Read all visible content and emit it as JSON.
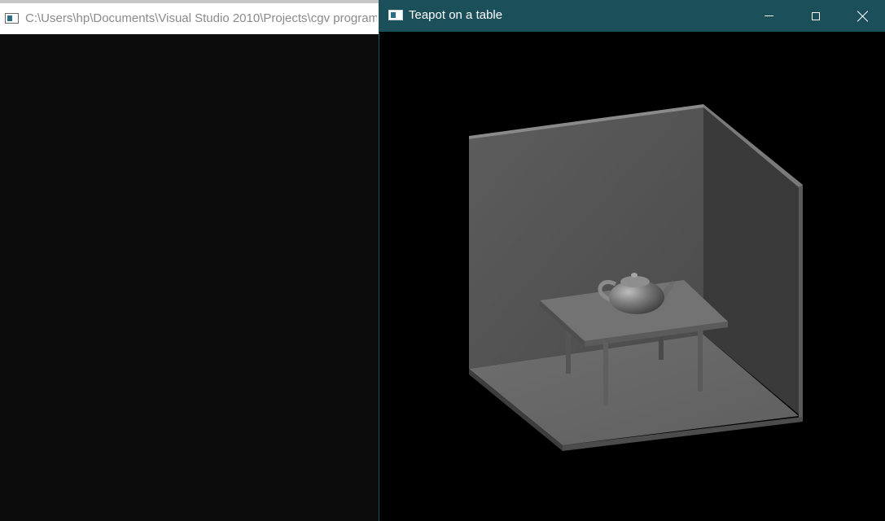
{
  "console_window": {
    "title": "C:\\Users\\hp\\Documents\\Visual Studio 2010\\Projects\\cgv program"
  },
  "gl_window": {
    "title": "Teapot on a table",
    "controls": {
      "minimize": "minimize",
      "maximize": "maximize",
      "close": "close"
    }
  },
  "icons": {
    "console": "console-app-icon",
    "gl": "app-window-icon"
  },
  "colors": {
    "titlebar_active": "#1b4f5a",
    "console_bg": "#0c0c0c",
    "scene_bg": "#000000"
  }
}
